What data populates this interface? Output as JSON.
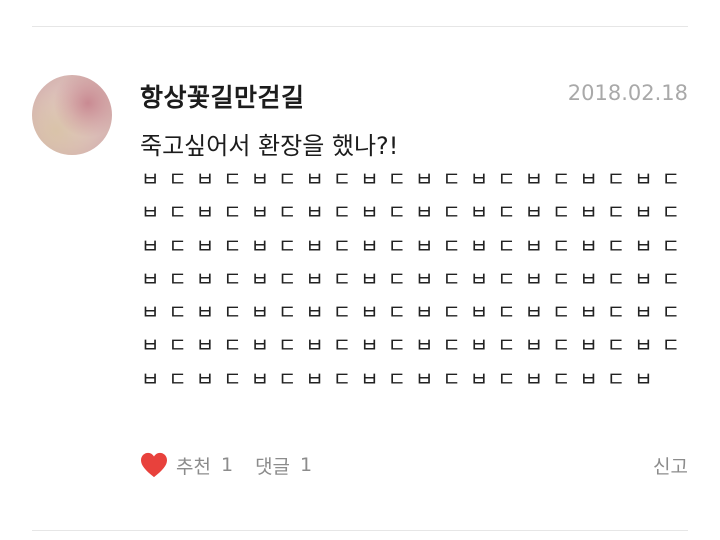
{
  "post": {
    "author": "항상꽃길만걷길",
    "date": "2018.02.18",
    "title": "죽고싶어서 환장을 했나?!",
    "body": "ㅂㄷㅂㄷㅂㄷㅂㄷㅂㄷㅂㄷㅂㄷㅂㄷㅂㄷㅂㄷㅂㄷㅂㄷㅂㄷㅂㄷㅂㄷㅂㄷㅂㄷㅂㄷㅂㄷㅂㄷㅂㄷㅂㄷㅂㄷㅂㄷㅂㄷㅂㄷㅂㄷㅂㄷㅂㄷㅂㄷㅂㄷㅂㄷㅂㄷㅂㄷㅂㄷㅂㄷㅂㄷㅂㄷㅂㄷㅂㄷㅂㄷㅂㄷㅂㄷㅂㄷㅂㄷㅂㄷㅂㄷㅂㄷㅂㄷㅂㄷㅂㄷㅂㄷㅂㄷㅂㄷㅂㄷㅂㄷㅂㄷㅂㄷㅂㄷㅂㄷㅂㄷㅂㄷㅂㄷㅂㄷㅂㄷㅂㄷㅂㄷㅂㄷㅂㄷㅂ"
  },
  "footer": {
    "like_label": "추천",
    "like_count": "1",
    "comment_label": "댓글",
    "comment_count": "1",
    "report_label": "신고"
  },
  "icons": {
    "avatar": "avatar-image",
    "like": "heart-icon"
  },
  "colors": {
    "heart": "#e8413c",
    "date": "#a9a9a9",
    "footer_text": "#8c8c8c",
    "divider": "#e6e6e6"
  }
}
